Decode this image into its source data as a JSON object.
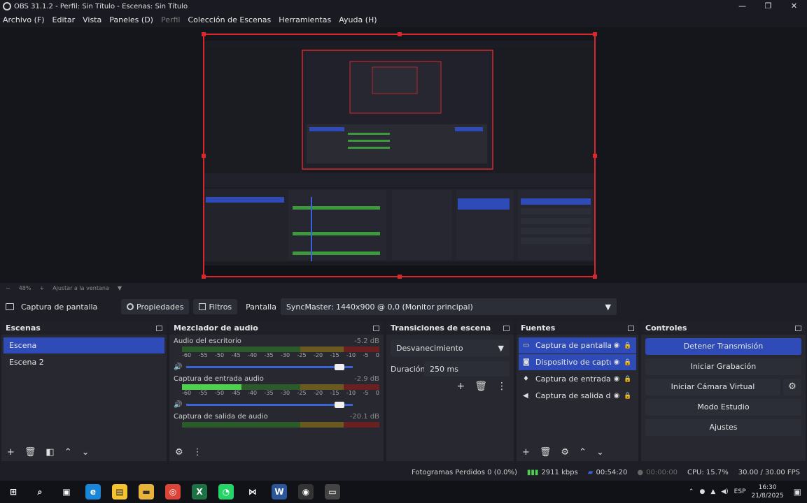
{
  "window": {
    "title": "OBS 31.1.2 - Perfil: Sin Título - Escenas: Sin Título",
    "buttons": [
      "—",
      "❐",
      "✕"
    ]
  },
  "menu": [
    {
      "label": "Archivo (F)",
      "enabled": true
    },
    {
      "label": "Editar",
      "enabled": true
    },
    {
      "label": "Vista",
      "enabled": true
    },
    {
      "label": "Paneles (D)",
      "enabled": true
    },
    {
      "label": "Perfil",
      "enabled": false
    },
    {
      "label": "Colección de Escenas",
      "enabled": true
    },
    {
      "label": "Herramientas",
      "enabled": true
    },
    {
      "label": "Ayuda (H)",
      "enabled": true
    }
  ],
  "zoom": {
    "out": "−",
    "level": "48%",
    "in": "+",
    "fit": "Ajustar a la ventana"
  },
  "toolbar": {
    "source_name": "Captura de pantalla",
    "properties": "Propiedades",
    "filters": "Filtros",
    "display_label": "Pantalla",
    "display_value": "SyncMaster: 1440x900 @ 0,0 (Monitor principal)"
  },
  "scenes": {
    "title": "Escenas",
    "items": [
      "Escena",
      "Escena 2"
    ],
    "active": 0
  },
  "mixer": {
    "title": "Mezclador de audio",
    "ticks": [
      "-60",
      "-55",
      "-50",
      "-45",
      "-40",
      "-35",
      "-30",
      "-25",
      "-20",
      "-15",
      "-10",
      "-5",
      "0"
    ],
    "channels": [
      {
        "name": "Audio del escritorio",
        "db": "-5.2 dB",
        "level": 0,
        "volume": 0.95
      },
      {
        "name": "Captura de entrada audio",
        "db": "-2.9 dB",
        "level": 0.3,
        "volume": 0.95
      },
      {
        "name": "Captura de salida de audio",
        "db": "-20.1 dB",
        "level": 0,
        "volume": 0.95
      }
    ]
  },
  "transitions": {
    "title": "Transiciones de escena",
    "type": "Desvanecimiento",
    "duration_label": "Duración",
    "duration_value": "250 ms"
  },
  "sources": {
    "title": "Fuentes",
    "items": [
      {
        "name": "Captura de pantalla",
        "icon": "monitor-icon",
        "selected": true
      },
      {
        "name": "Dispositivo de captura",
        "icon": "camera-icon",
        "selected": true
      },
      {
        "name": "Captura de entrada a",
        "icon": "mic-icon",
        "selected": false
      },
      {
        "name": "Captura de salida de a",
        "icon": "speaker-icon",
        "selected": false
      }
    ]
  },
  "controls": {
    "title": "Controles",
    "stop_stream": "Detener Transmisión",
    "start_record": "Iniciar Grabación",
    "virtual_cam": "Iniciar Cámara Virtual",
    "studio": "Modo Estudio",
    "settings": "Ajustes"
  },
  "status": {
    "dropped": "Fotogramas Perdidos 0 (0.0%)",
    "bitrate": "2911 kbps",
    "stream_time": "00:54:20",
    "rec_time": "00:00:00",
    "cpu": "CPU: 15.7%",
    "fps": "30.00 / 30.00 FPS"
  },
  "taskbar": {
    "lang": "ESP",
    "time": "16:30",
    "date": "21/8/2025"
  },
  "colors": {
    "accent": "#2e4bb8",
    "selection": "#d9272e",
    "background": "#1e1f26"
  }
}
